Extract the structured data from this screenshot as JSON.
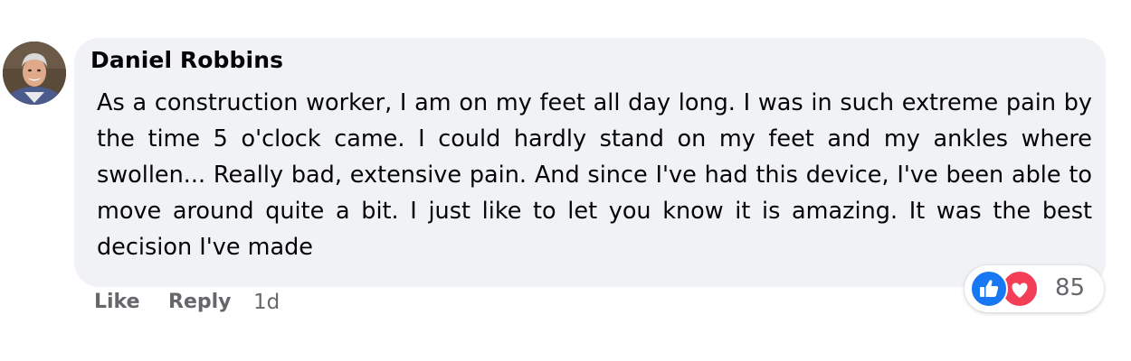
{
  "comment": {
    "author": "Daniel Robbins",
    "text": "As a construction worker, I am on my feet all day long. I was in such extreme pain by the time 5 o'clock came. I could hardly stand on my feet and my ankles where swollen... Really bad, extensive pain. And since I've had this device, I've been able to move around quite a bit. I just like to let you know it is amazing. It was the best decision I've made",
    "avatar": {
      "icon": "user-photo"
    },
    "reactions": {
      "count": "85",
      "icons": [
        "like-icon",
        "love-icon"
      ],
      "colors": {
        "like": "#1877f2",
        "love": "#f33e58"
      }
    },
    "actions": {
      "like_label": "Like",
      "reply_label": "Reply",
      "timestamp": "1d"
    }
  },
  "colors": {
    "bubble_background": "#f0f2f5",
    "text": "#050505",
    "secondary_text": "#65676b"
  }
}
